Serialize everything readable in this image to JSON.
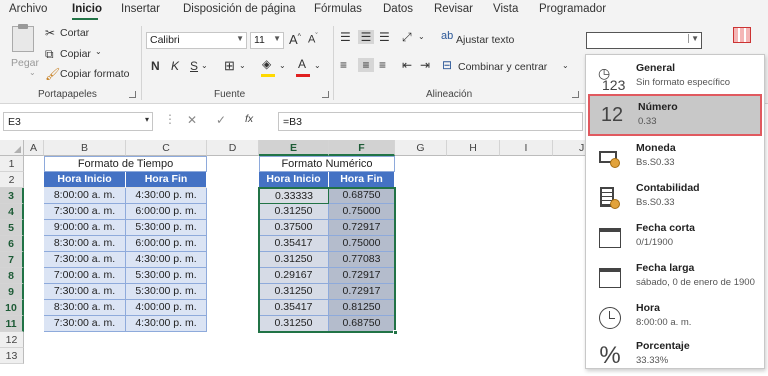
{
  "menu": {
    "tabs": [
      "Archivo",
      "Inicio",
      "Insertar",
      "Disposición de página",
      "Fórmulas",
      "Datos",
      "Revisar",
      "Vista",
      "Programador"
    ]
  },
  "ribbon": {
    "clipboard": {
      "paste": "Pegar",
      "cut": "Cortar",
      "copy": "Copiar",
      "format_painter": "Copiar formato",
      "group": "Portapapeles"
    },
    "font": {
      "name": "Calibri",
      "size": "11",
      "bold": "N",
      "italic": "K",
      "underline": "S",
      "grow": "A",
      "shrink": "A",
      "group": "Fuente"
    },
    "alignment": {
      "wrap": "Ajustar texto",
      "merge": "Combinar y centrar",
      "group": "Alineación"
    },
    "number_format_value": ""
  },
  "formula_bar": {
    "name_box": "E3",
    "fx": "fx",
    "formula": "=B3"
  },
  "columns": [
    "A",
    "B",
    "C",
    "D",
    "E",
    "F",
    "G",
    "H",
    "I",
    "J"
  ],
  "rows": [
    "1",
    "2",
    "3",
    "4",
    "5",
    "6",
    "7",
    "8",
    "9",
    "10",
    "11",
    "12",
    "13"
  ],
  "time_table": {
    "title": "Formato de Tiempo",
    "headers": [
      "Hora Inicio",
      "Hora Fin"
    ],
    "rows": [
      [
        "8:00:00 a. m.",
        "4:30:00 p. m."
      ],
      [
        "7:30:00 a. m.",
        "6:00:00 p. m."
      ],
      [
        "9:00:00 a. m.",
        "5:30:00 p. m."
      ],
      [
        "8:30:00 a. m.",
        "6:00:00 p. m."
      ],
      [
        "7:30:00 a. m.",
        "4:30:00 p. m."
      ],
      [
        "7:00:00 a. m.",
        "5:30:00 p. m."
      ],
      [
        "7:30:00 a. m.",
        "5:30:00 p. m."
      ],
      [
        "8:30:00 a. m.",
        "4:00:00 p. m."
      ],
      [
        "7:30:00 a. m.",
        "4:30:00 p. m."
      ]
    ]
  },
  "number_table": {
    "title": "Formato Numérico",
    "headers": [
      "Hora Inicio",
      "Hora Fin"
    ],
    "rows": [
      [
        "0.33333",
        "0.68750"
      ],
      [
        "0.31250",
        "0.75000"
      ],
      [
        "0.37500",
        "0.72917"
      ],
      [
        "0.35417",
        "0.75000"
      ],
      [
        "0.31250",
        "0.77083"
      ],
      [
        "0.29167",
        "0.72917"
      ],
      [
        "0.31250",
        "0.72917"
      ],
      [
        "0.35417",
        "0.81250"
      ],
      [
        "0.31250",
        "0.68750"
      ]
    ]
  },
  "format_menu": {
    "items": [
      {
        "title": "General",
        "sub": "Sin formato específico",
        "icon": "general-123-icon"
      },
      {
        "title": "Número",
        "sub": "0.33",
        "icon": "number-12-icon"
      },
      {
        "title": "Moneda",
        "sub": "Bs.S0.33",
        "icon": "currency-icon"
      },
      {
        "title": "Contabilidad",
        "sub": "Bs.S0.33",
        "icon": "accounting-icon"
      },
      {
        "title": "Fecha corta",
        "sub": "0/1/1900",
        "icon": "calendar-icon"
      },
      {
        "title": "Fecha larga",
        "sub": "sábado, 0 de enero de 1900",
        "icon": "calendar-icon"
      },
      {
        "title": "Hora",
        "sub": "8:00:00 a. m.",
        "icon": "clock-icon"
      },
      {
        "title": "Porcentaje",
        "sub": "33.33%",
        "icon": "percent-icon"
      }
    ],
    "icons_text": {
      "general": "123",
      "number": "12",
      "percent": "%"
    }
  },
  "colors": {
    "accent": "#217346",
    "table_header": "#4472c4",
    "highlight_border": "#e0595f"
  }
}
